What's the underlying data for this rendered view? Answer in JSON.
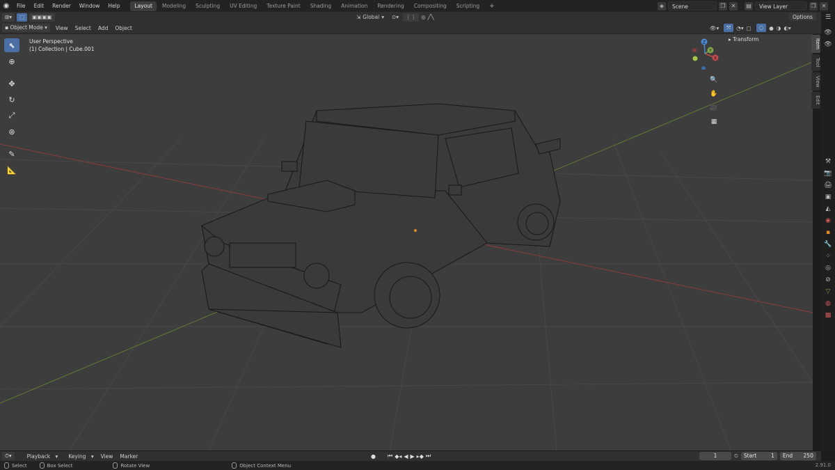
{
  "topbar": {
    "menus": [
      "File",
      "Edit",
      "Render",
      "Window",
      "Help"
    ],
    "workspaces": [
      "Layout",
      "Modeling",
      "Sculpting",
      "UV Editing",
      "Texture Paint",
      "Shading",
      "Animation",
      "Rendering",
      "Compositing",
      "Scripting"
    ],
    "active_workspace": "Layout",
    "scene": "Scene",
    "view_layer": "View Layer"
  },
  "header2": {
    "transform": "Global",
    "options": "Options"
  },
  "header3": {
    "mode": "Object Mode",
    "menus": [
      "View",
      "Select",
      "Add",
      "Object"
    ]
  },
  "viewport": {
    "perspective": "User Perspective",
    "collection": "(1) Collection | Cube.001"
  },
  "npanel": {
    "section": "Transform",
    "tabs": [
      "Item",
      "Tool",
      "View",
      "Edit"
    ]
  },
  "gizmo": {
    "x": "X",
    "y": "Y",
    "z": "Z"
  },
  "timeline": {
    "menus": [
      "Playback",
      "Keying",
      "View",
      "Marker"
    ],
    "current_frame": "1",
    "start_label": "Start",
    "start": "1",
    "end_label": "End",
    "end": "250"
  },
  "statusbar": {
    "select": "Select",
    "box_select": "Box Select",
    "rotate": "Rotate View",
    "context": "Object Context Menu",
    "version": "2.91.0"
  },
  "colors": {
    "accent": "#4a6fa5",
    "x_axis": "#c44b4b",
    "y_axis": "#7fa34a",
    "z_axis": "#4a8ad4",
    "viewport_bg": "#3d3d3d"
  }
}
